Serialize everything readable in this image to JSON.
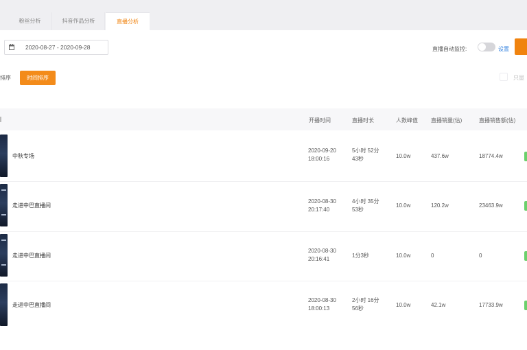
{
  "tabs": [
    {
      "label": "粉丝分析",
      "active": false
    },
    {
      "label": "抖音作品分析",
      "active": false
    },
    {
      "label": "直播分析",
      "active": true
    }
  ],
  "date_range": {
    "value": "2020-08-27 - 2020-09-28",
    "icon": "calendar-icon"
  },
  "monitor": {
    "label": "直播自动监控:",
    "enabled": false,
    "settings_label": "设置"
  },
  "sort": {
    "left_label": "排序",
    "active_label": "时间排序"
  },
  "filter": {
    "label": "只显"
  },
  "table": {
    "headers": [
      "开播时间",
      "直播时长",
      "人数峰值",
      "直播销量(估)",
      "直播销售额(估)"
    ],
    "rows": [
      {
        "title": "中秋专场",
        "start_line1": "2020-09-20",
        "start_line2": "18:00:16",
        "duration_line1": "5小时 52分",
        "duration_line2": "43秒",
        "peak": "10.0w",
        "sales": "437.6w",
        "revenue": "18774.4w"
      },
      {
        "title": "走进中巴直播间",
        "start_line1": "2020-08-30",
        "start_line2": "20:17:40",
        "duration_line1": "4小时 35分",
        "duration_line2": "53秒",
        "peak": "10.0w",
        "sales": "120.2w",
        "revenue": "23463.9w"
      },
      {
        "title": "走进中巴直播间",
        "start_line1": "2020-08-30",
        "start_line2": "20:16:41",
        "duration_line1": "1分3秒",
        "duration_line2": "",
        "peak": "10.0w",
        "sales": "0",
        "revenue": "0"
      },
      {
        "title": "走进中巴直播间",
        "start_line1": "2020-08-30",
        "start_line2": "18:00:13",
        "duration_line1": "2小时 16分",
        "duration_line2": "56秒",
        "peak": "10.0w",
        "sales": "42.1w",
        "revenue": "17733.9w"
      }
    ]
  },
  "colors": {
    "accent": "#f0830f",
    "link": "#3a86e0",
    "success": "#6cd06c"
  }
}
